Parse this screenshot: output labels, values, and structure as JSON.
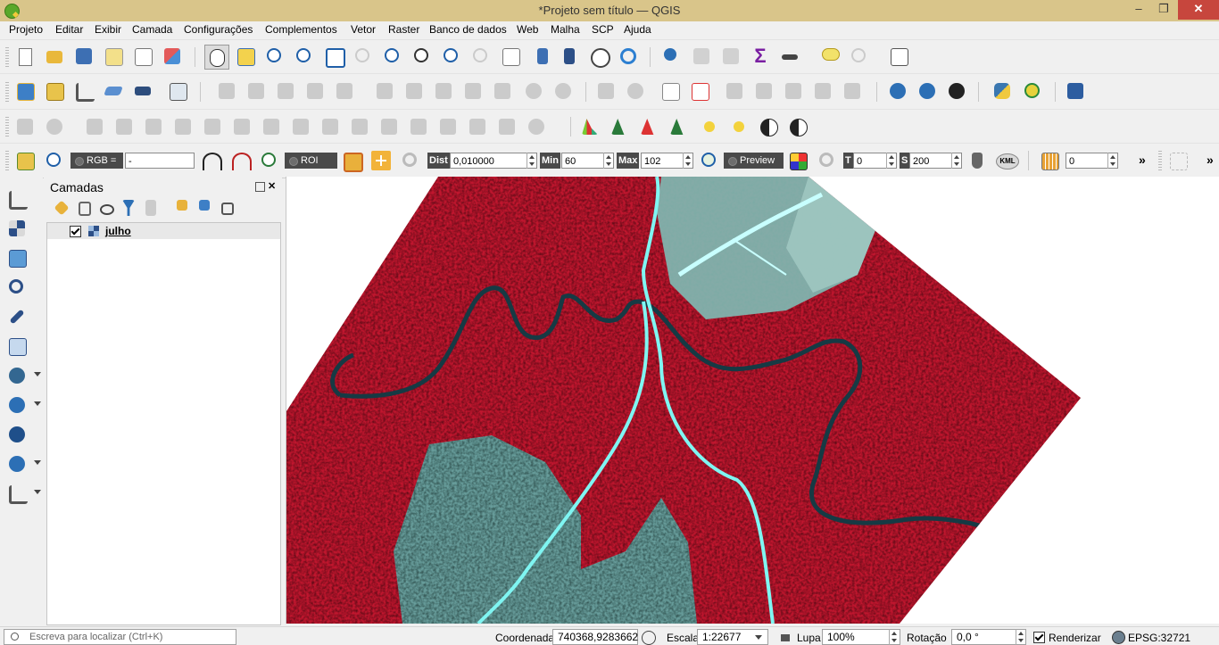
{
  "window": {
    "title": "*Projeto sem título — QGIS",
    "minimize": "–",
    "restore": "❐",
    "close": "✕"
  },
  "menu": [
    "Projeto",
    "Editar",
    "Exibir",
    "Camada",
    "Configurações",
    "Complementos",
    "Vetor",
    "Raster",
    "Banco de dados",
    "Web",
    "Malha",
    "SCP",
    "Ajuda"
  ],
  "scp_toolbar": {
    "rgb_label": "RGB =",
    "rgb_value": "-",
    "roi_label": "ROI",
    "dist_label": "Dist",
    "dist_value": "0,010000",
    "min_label": "Min",
    "min_value": "60",
    "max_label": "Max",
    "max_value": "102",
    "preview_label": "Preview",
    "t_label": "T",
    "t_value": "0",
    "s_label": "S",
    "s_value": "200",
    "kml_label": "KML",
    "band_value": "0",
    "more": "»"
  },
  "layers_panel": {
    "title": "Camadas",
    "layers": [
      {
        "name": "julho",
        "checked": true
      }
    ]
  },
  "statusbar": {
    "locate_placeholder": "Escreva para localizar (Ctrl+K)",
    "coord_label": "Coordenada",
    "coord_value": "740368,9283662",
    "scale_label": "Escala",
    "scale_value": "1:22677",
    "magnifier_label": "Lupa",
    "magnifier_value": "100%",
    "rotation_label": "Rotação",
    "rotation_value": "0,0 °",
    "render_label": "Renderizar",
    "crs_label": "EPSG:32721"
  },
  "colors": {
    "titlebar": "#d9c58a",
    "close": "#c7463d",
    "forest": "#c0162e",
    "clearing": "#5fa8a4",
    "river": "#163a44",
    "road": "#7ff5f2"
  }
}
